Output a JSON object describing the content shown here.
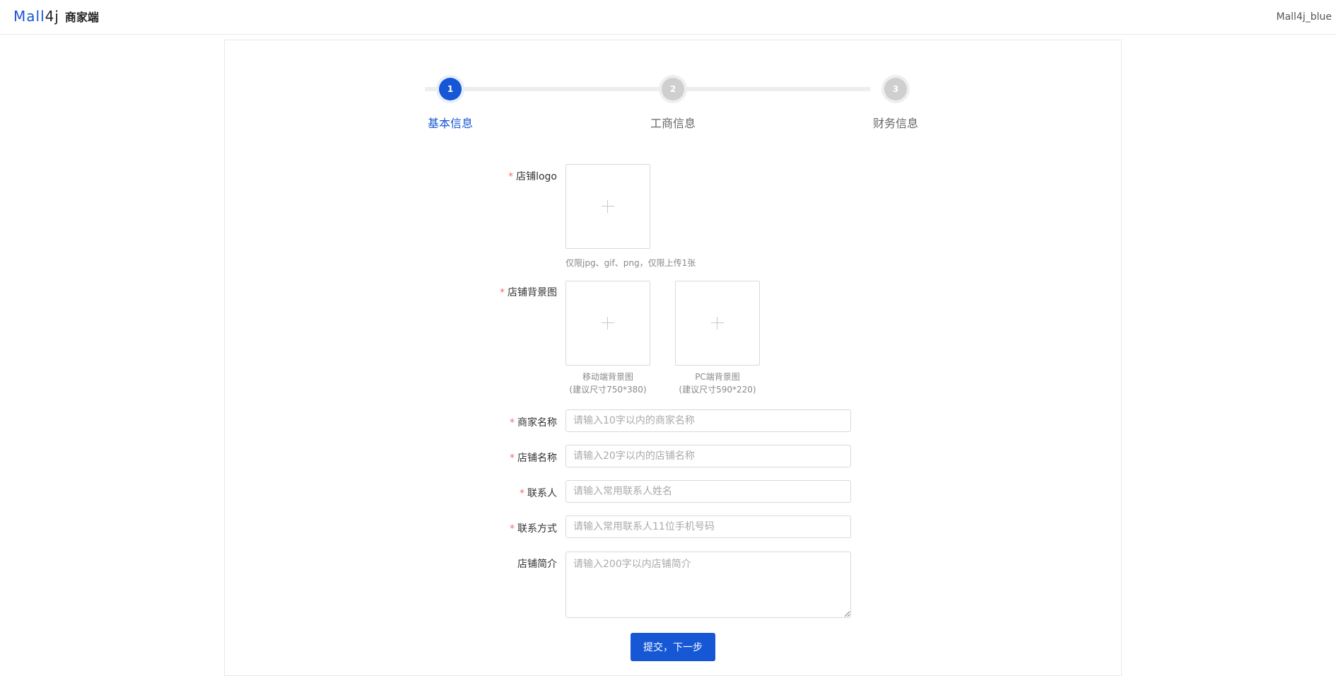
{
  "header": {
    "logo_text_blue": "Mall",
    "logo_text_dark": "4j",
    "logo_subtitle": "商家端",
    "user_name": "Mall4j_blue"
  },
  "steps": [
    {
      "number": "1",
      "label": "基本信息",
      "active": true
    },
    {
      "number": "2",
      "label": "工商信息",
      "active": false
    },
    {
      "number": "3",
      "label": "财务信息",
      "active": false
    }
  ],
  "form": {
    "logo": {
      "label": "店铺logo",
      "required": true,
      "hint": "仅限jpg、gif、png，仅限上传1张"
    },
    "background": {
      "label": "店铺背景图",
      "required": true,
      "mobile_caption_line1": "移动端背景图",
      "mobile_caption_line2": "(建议尺寸750*380)",
      "pc_caption_line1": "PC端背景图",
      "pc_caption_line2": "(建议尺寸590*220)"
    },
    "merchant_name": {
      "label": "商家名称",
      "required": true,
      "placeholder": "请输入10字以内的商家名称",
      "value": ""
    },
    "shop_name": {
      "label": "店铺名称",
      "required": true,
      "placeholder": "请输入20字以内的店铺名称",
      "value": ""
    },
    "contact": {
      "label": "联系人",
      "required": true,
      "placeholder": "请输入常用联系人姓名",
      "value": ""
    },
    "phone": {
      "label": "联系方式",
      "required": true,
      "placeholder": "请输入常用联系人11位手机号码",
      "value": ""
    },
    "intro": {
      "label": "店铺简介",
      "required": false,
      "placeholder": "请输入200字以内店铺简介",
      "value": ""
    },
    "submit_label": "提交，下一步",
    "required_mark": "*"
  },
  "colors": {
    "primary": "#1657d6",
    "required": "#f56c6c",
    "inactive_step": "#cfcfcf"
  },
  "icons": {
    "upload": "plus-icon"
  }
}
